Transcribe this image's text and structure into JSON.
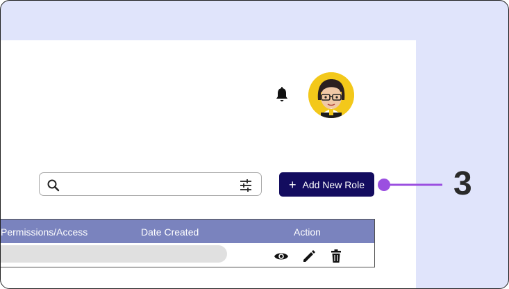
{
  "header": {
    "notification_icon": "bell-icon",
    "avatar_icon": "user-avatar"
  },
  "search": {
    "placeholder": "",
    "search_icon": "search-icon",
    "filter_icon": "filter-sliders-icon"
  },
  "add_role_button": {
    "icon": "plus",
    "label": "Add New Role"
  },
  "annotation": {
    "step_number": "3",
    "color": "#9b4fe0"
  },
  "table": {
    "columns": [
      "Permissions/Access",
      "Date Created",
      "Action"
    ],
    "row_actions": [
      "eye-icon",
      "pencil-icon",
      "trash-icon"
    ]
  },
  "colors": {
    "background": "#e0e4fb",
    "primary_button": "#130c5f",
    "table_header": "#7a83be"
  }
}
